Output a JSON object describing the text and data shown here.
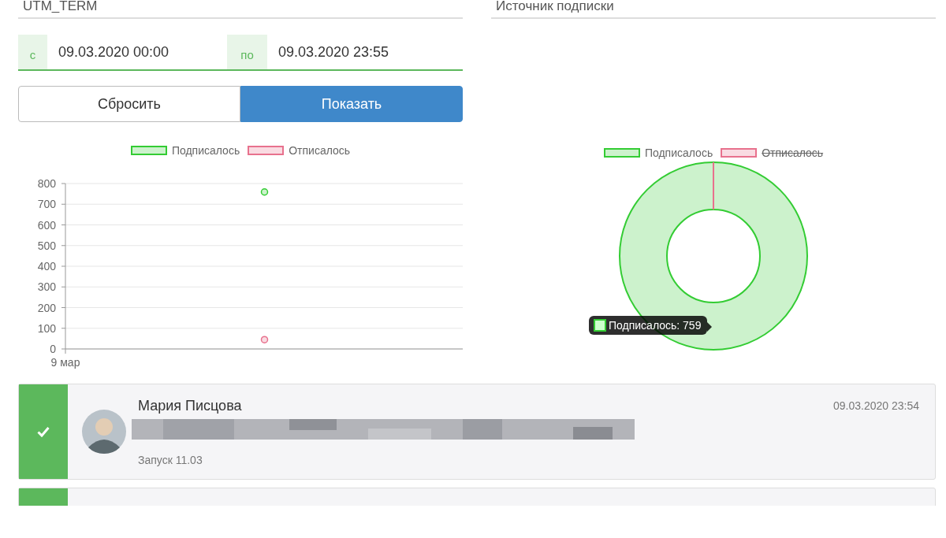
{
  "left_panel": {
    "heading": "UTM_TERM",
    "date_range": {
      "from_label": "с",
      "from_value": "09.03.2020 00:00",
      "to_label": "по",
      "to_value": "09.03.2020 23:55"
    },
    "buttons": [
      {
        "label": "Сбросить",
        "kind": "secondary"
      },
      {
        "label": "Показать",
        "kind": "primary"
      }
    ],
    "chart_data": {
      "type": "scatter",
      "grid": true,
      "legend": "top",
      "annotations": [
        {
          "text": "9 мар"
        }
      ],
      "ylim": [
        0,
        800
      ],
      "yticks": [
        0,
        100,
        200,
        300,
        400,
        500,
        600,
        700,
        800
      ],
      "series": [
        {
          "name": "Подписалось",
          "color": "#33cc33",
          "values": [
            759
          ]
        },
        {
          "name": "Отписалось",
          "color": "#e8718d",
          "values": [
            45
          ]
        }
      ]
    }
  },
  "right_panel": {
    "heading": "Источник подписки",
    "legend": [
      {
        "label": "Подписалось",
        "color": "#33cc33",
        "hidden": false
      },
      {
        "label": "Отписалось",
        "color": "#e8718d",
        "hidden": true
      }
    ],
    "tooltip": {
      "text": "Подписалось: 759",
      "color": "#33cc33"
    }
  },
  "feed": [
    {
      "name": "Мария Писцова",
      "time": "09.03.2020 23:54",
      "note": "Запуск 11.03",
      "verified": true,
      "redacted": true
    },
    {
      "verified": true
    }
  ]
}
